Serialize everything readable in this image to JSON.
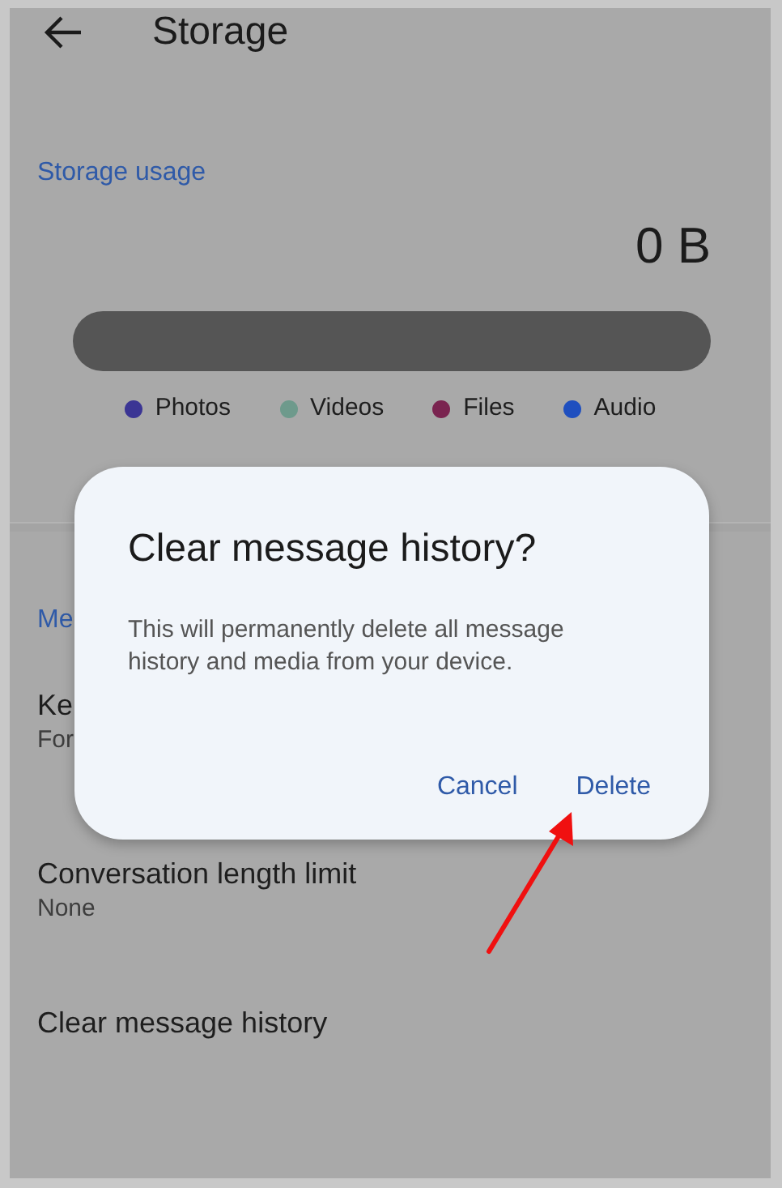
{
  "header": {
    "title": "Storage"
  },
  "storage": {
    "section_title": "Storage usage",
    "total": "0 B",
    "legend": [
      {
        "label": "Photos",
        "color": "#3b3594"
      },
      {
        "label": "Videos",
        "color": "#6e9a8c"
      },
      {
        "label": "Files",
        "color": "#7a2450"
      },
      {
        "label": "Audio",
        "color": "#1f4fbf"
      }
    ]
  },
  "settings": {
    "section_title": "Me",
    "items": [
      {
        "title": "Ke",
        "subtitle": "For"
      },
      {
        "title": "Conversation length limit",
        "subtitle": "None"
      },
      {
        "title": "Clear message history"
      }
    ]
  },
  "dialog": {
    "title": "Clear message history?",
    "message": "This will permanently delete all message history and media from your device.",
    "buttons": [
      "Cancel",
      "Delete"
    ]
  }
}
